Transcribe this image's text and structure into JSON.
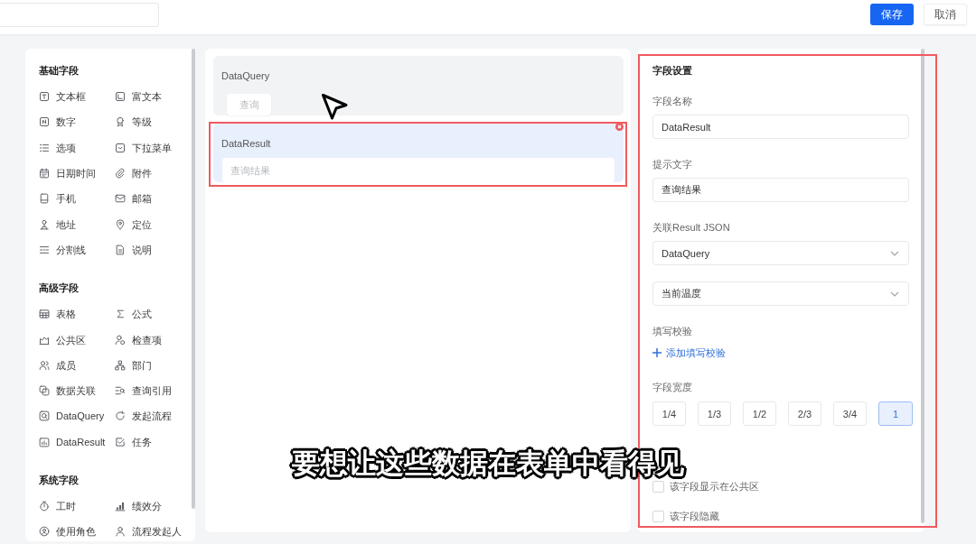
{
  "top_bar": {
    "buttons": [
      {
        "label": "保存",
        "kind": "primary"
      },
      {
        "label": "取消",
        "kind": "default"
      }
    ]
  },
  "palette": {
    "sections": [
      {
        "title": "基础字段",
        "items": [
          {
            "label": "文本框"
          },
          {
            "label": "富文本"
          },
          {
            "label": "数字"
          },
          {
            "label": "等级"
          },
          {
            "label": "选项"
          },
          {
            "label": "下拉菜单"
          },
          {
            "label": "日期时间"
          },
          {
            "label": "附件"
          },
          {
            "label": "手机"
          },
          {
            "label": "邮箱"
          },
          {
            "label": "地址"
          },
          {
            "label": "定位"
          },
          {
            "label": "分割线"
          },
          {
            "label": "说明"
          }
        ]
      },
      {
        "title": "高级字段",
        "items": [
          {
            "label": "表格"
          },
          {
            "label": "公式"
          },
          {
            "label": "公共区"
          },
          {
            "label": "检查项"
          },
          {
            "label": "成员"
          },
          {
            "label": "部门"
          },
          {
            "label": "数据关联"
          },
          {
            "label": "查询引用"
          },
          {
            "label": "DataQuery"
          },
          {
            "label": "发起流程"
          },
          {
            "label": "DataResult"
          },
          {
            "label": "任务"
          }
        ]
      },
      {
        "title": "系统字段",
        "items": [
          {
            "label": "工时"
          },
          {
            "label": "绩效分"
          },
          {
            "label": "使用角色"
          },
          {
            "label": "流程发起人"
          }
        ]
      }
    ]
  },
  "canvas": {
    "fields": [
      {
        "label": "DataQuery",
        "kind": "button",
        "button_label": "查询",
        "selected": false,
        "highlighted": false
      },
      {
        "label": "DataResult",
        "kind": "input",
        "placeholder": "查询结果",
        "selected": true,
        "highlighted": true
      }
    ]
  },
  "settings": {
    "title": "字段设置",
    "highlighted": true,
    "groups": [
      {
        "kind": "input",
        "label": "字段名称",
        "value": "DataResult"
      },
      {
        "kind": "input",
        "label": "提示文字",
        "value": "查询结果"
      },
      {
        "kind": "select",
        "label": "关联Result JSON",
        "values": [
          "DataQuery",
          "当前温度"
        ]
      },
      {
        "kind": "link",
        "label": "填写校验",
        "link": "添加填写校验"
      },
      {
        "kind": "segments",
        "label": "字段宽度",
        "options": [
          {
            "label": "1/4",
            "selected": false
          },
          {
            "label": "1/3",
            "selected": false
          },
          {
            "label": "1/2",
            "selected": false
          },
          {
            "label": "2/3",
            "selected": false
          },
          {
            "label": "3/4",
            "selected": false
          },
          {
            "label": "1",
            "selected": true
          }
        ]
      },
      {
        "kind": "checkboxes",
        "options": [
          {
            "label": "该字段显示在公共区",
            "checked": false
          },
          {
            "label": "该字段隐藏",
            "checked": false
          }
        ]
      }
    ]
  },
  "subtitle": "要想让这些数据在表单中看得见"
}
